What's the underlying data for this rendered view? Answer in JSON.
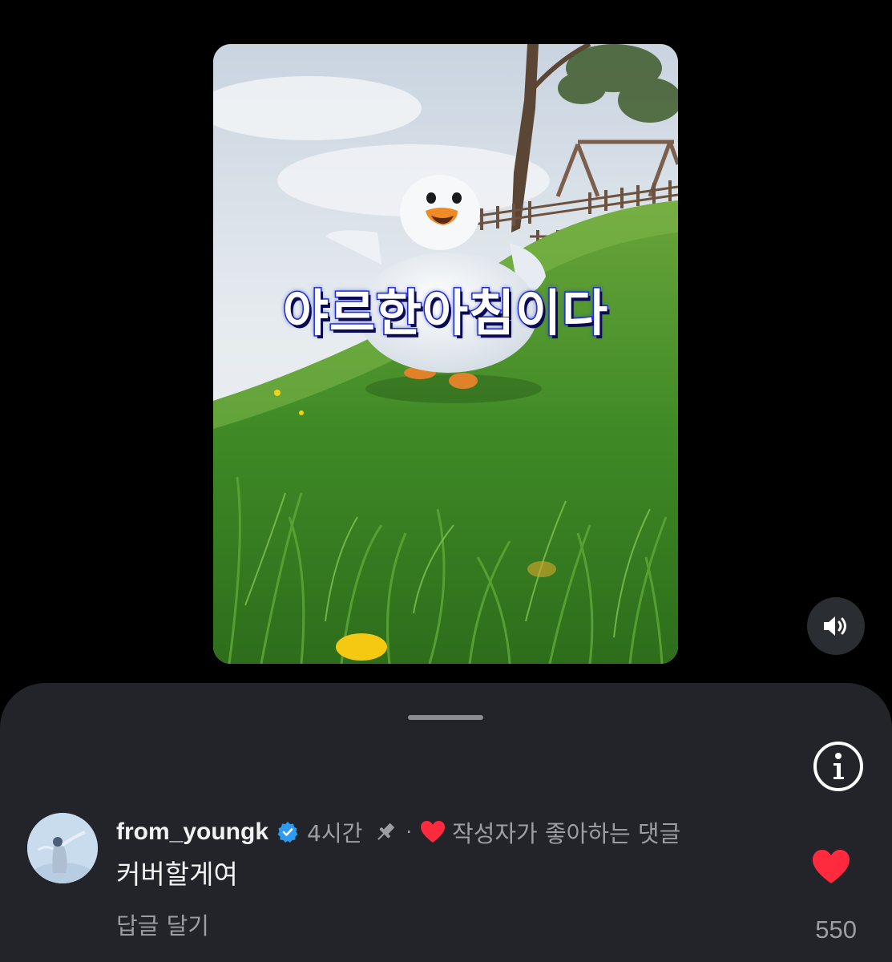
{
  "video": {
    "caption": "야르한아침이다",
    "sound_state": "unmuted"
  },
  "comment": {
    "username": "from_youngk",
    "verified": true,
    "time": "4시간",
    "pinned": true,
    "separator": "·",
    "creator_liked_label": "작성자가 좋아하는 댓글",
    "text": "커버할게여",
    "reply_label": "답글 달기",
    "like_count": "550",
    "liked": true
  },
  "colors": {
    "background": "#000000",
    "sheet": "#222429",
    "heart": "#ff2a3d",
    "verified": "#2f9bf0",
    "caption_stroke": "#1f2fd6",
    "muted_text": "#9c9ea3"
  },
  "icons": {
    "sound": "speaker-wave-icon",
    "info": "info-circle-icon",
    "verified": "verified-badge-icon",
    "pin": "pin-icon",
    "heart": "heart-icon"
  }
}
